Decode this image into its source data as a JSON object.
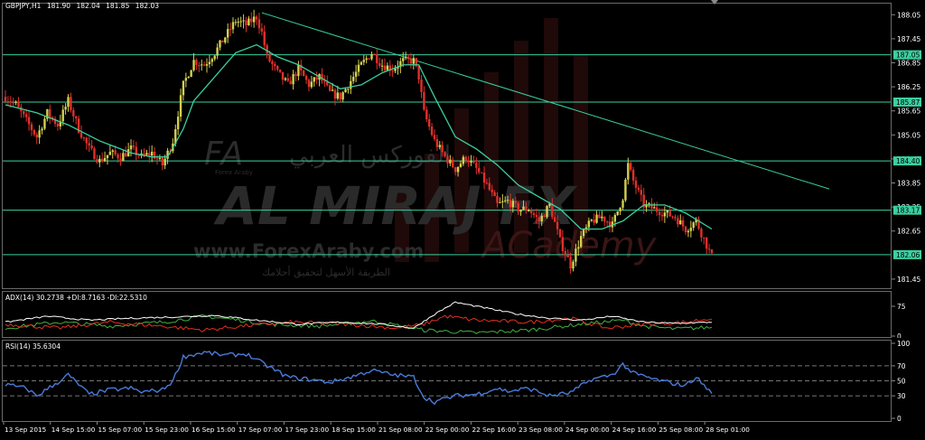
{
  "header": {
    "symbol": "GBPJPY,H1",
    "open": "181.90",
    "high": "182.04",
    "low": "181.85",
    "close": "182.03"
  },
  "adx_header": "ADX(14) 30.2738 +DI:8.7163 -DI:22.5310",
  "rsi_header": "RSI(14) 35.6304",
  "watermark": {
    "name": "AL MIRAJ FX",
    "url": "www.ForexAraby.com",
    "arabic_line": "الفوركس العربي",
    "arabic_tagline": "الطريقة الأسهل لتحقيق أحلامك",
    "academy": "ACademy",
    "logo_text": "FA",
    "logo_sub": "Forex Araby"
  },
  "colors": {
    "bull": "#d4d050",
    "bear": "#e0302a",
    "ma": "#3ad0a0",
    "level": "#3ad0a0",
    "trend": "#3ad0a0",
    "adx": "#ffffff",
    "plus_di": "#40b040",
    "minus_di": "#e03020",
    "rsi": "#4a7ad8",
    "price_label_bg": "#3ad0a0"
  },
  "chart_data": {
    "type": "candlestick",
    "price_ticks": [
      "188.05",
      "187.45",
      "186.85",
      "186.25",
      "185.65",
      "185.05",
      "184.45",
      "183.85",
      "183.25",
      "182.65",
      "181.45"
    ],
    "price_range": [
      181.2,
      188.35
    ],
    "levels": [
      "187.05",
      "185.87",
      "184.40",
      "183.17",
      "182.06"
    ],
    "trendline": {
      "start_price": 188.1,
      "end_price": 183.7
    },
    "time_labels": [
      "13 Sep 2015",
      "14 Sep 15:00",
      "15 Sep 07:00",
      "15 Sep 23:00",
      "16 Sep 15:00",
      "17 Sep 07:00",
      "17 Sep 23:00",
      "18 Sep 15:00",
      "21 Sep 08:00",
      "22 Sep 00:00",
      "22 Sep 16:00",
      "23 Sep 08:00",
      "24 Sep 00:00",
      "24 Sep 16:00",
      "25 Sep 08:00",
      "28 Sep 01:00"
    ],
    "adx": {
      "ticks": [
        "75",
        "0"
      ],
      "range": [
        0,
        100
      ]
    },
    "rsi": {
      "ticks": [
        "100",
        "70",
        "50",
        "30",
        "0"
      ],
      "levels": [
        70,
        50,
        30
      ],
      "range": [
        0,
        100
      ]
    },
    "price_path": [
      [
        0,
        186.0
      ],
      [
        2,
        185.8
      ],
      [
        4,
        185.4
      ],
      [
        6,
        185.0
      ],
      [
        8,
        185.6
      ],
      [
        10,
        185.3
      ],
      [
        12,
        185.9
      ],
      [
        14,
        185.2
      ],
      [
        16,
        184.7
      ],
      [
        18,
        184.4
      ],
      [
        20,
        184.6
      ],
      [
        22,
        184.5
      ],
      [
        24,
        184.7
      ],
      [
        26,
        184.5
      ],
      [
        28,
        184.6
      ],
      [
        30,
        184.3
      ],
      [
        32,
        184.9
      ],
      [
        34,
        186.3
      ],
      [
        36,
        186.9
      ],
      [
        38,
        186.8
      ],
      [
        40,
        187.1
      ],
      [
        42,
        187.5
      ],
      [
        44,
        187.9
      ],
      [
        46,
        187.8
      ],
      [
        48,
        188.0
      ],
      [
        49,
        187.6
      ],
      [
        50,
        187.0
      ],
      [
        52,
        186.6
      ],
      [
        54,
        186.3
      ],
      [
        56,
        186.7
      ],
      [
        58,
        186.3
      ],
      [
        60,
        186.5
      ],
      [
        62,
        186.1
      ],
      [
        64,
        186.0
      ],
      [
        66,
        186.4
      ],
      [
        68,
        186.8
      ],
      [
        70,
        187.1
      ],
      [
        72,
        186.8
      ],
      [
        74,
        186.7
      ],
      [
        76,
        186.9
      ],
      [
        78,
        186.9
      ],
      [
        79,
        186.5
      ],
      [
        80,
        185.6
      ],
      [
        82,
        184.9
      ],
      [
        84,
        184.5
      ],
      [
        86,
        184.2
      ],
      [
        88,
        184.5
      ],
      [
        90,
        184.2
      ],
      [
        92,
        183.8
      ],
      [
        94,
        183.3
      ],
      [
        96,
        183.4
      ],
      [
        98,
        183.2
      ],
      [
        100,
        183.2
      ],
      [
        102,
        182.9
      ],
      [
        104,
        183.3
      ],
      [
        106,
        182.4
      ],
      [
        108,
        181.8
      ],
      [
        110,
        182.5
      ],
      [
        112,
        182.9
      ],
      [
        114,
        183.0
      ],
      [
        116,
        182.8
      ],
      [
        118,
        183.5
      ],
      [
        119,
        184.3
      ],
      [
        120,
        183.9
      ],
      [
        122,
        183.3
      ],
      [
        124,
        183.2
      ],
      [
        126,
        183.1
      ],
      [
        128,
        183.0
      ],
      [
        130,
        182.7
      ],
      [
        132,
        182.9
      ],
      [
        134,
        182.3
      ],
      [
        135,
        182.0
      ]
    ],
    "ma_path": [
      [
        0,
        185.8
      ],
      [
        6,
        185.6
      ],
      [
        12,
        185.3
      ],
      [
        18,
        184.9
      ],
      [
        24,
        184.6
      ],
      [
        28,
        184.5
      ],
      [
        31,
        184.5
      ],
      [
        34,
        185.2
      ],
      [
        36,
        185.9
      ],
      [
        40,
        186.5
      ],
      [
        44,
        187.1
      ],
      [
        48,
        187.3
      ],
      [
        52,
        187.0
      ],
      [
        56,
        186.8
      ],
      [
        60,
        186.5
      ],
      [
        64,
        186.2
      ],
      [
        68,
        186.3
      ],
      [
        72,
        186.6
      ],
      [
        76,
        186.8
      ],
      [
        79,
        186.8
      ],
      [
        82,
        186.0
      ],
      [
        86,
        185.0
      ],
      [
        90,
        184.7
      ],
      [
        94,
        184.3
      ],
      [
        98,
        183.8
      ],
      [
        102,
        183.5
      ],
      [
        106,
        183.2
      ],
      [
        110,
        182.7
      ],
      [
        114,
        182.7
      ],
      [
        118,
        182.9
      ],
      [
        122,
        183.3
      ],
      [
        126,
        183.3
      ],
      [
        130,
        183.1
      ],
      [
        135,
        182.7
      ]
    ],
    "adx_plus_path": [
      [
        0,
        20
      ],
      [
        10,
        35
      ],
      [
        20,
        25
      ],
      [
        30,
        35
      ],
      [
        38,
        50
      ],
      [
        45,
        40
      ],
      [
        50,
        30
      ],
      [
        60,
        25
      ],
      [
        70,
        38
      ],
      [
        80,
        15
      ],
      [
        90,
        8
      ],
      [
        100,
        15
      ],
      [
        110,
        30
      ],
      [
        118,
        40
      ],
      [
        122,
        25
      ],
      [
        128,
        18
      ],
      [
        135,
        22
      ]
    ],
    "adx_minus_path": [
      [
        0,
        30
      ],
      [
        10,
        20
      ],
      [
        20,
        35
      ],
      [
        30,
        25
      ],
      [
        38,
        15
      ],
      [
        45,
        25
      ],
      [
        55,
        35
      ],
      [
        65,
        30
      ],
      [
        75,
        20
      ],
      [
        80,
        30
      ],
      [
        84,
        50
      ],
      [
        90,
        40
      ],
      [
        100,
        35
      ],
      [
        108,
        45
      ],
      [
        115,
        20
      ],
      [
        122,
        30
      ],
      [
        130,
        35
      ],
      [
        135,
        45
      ]
    ],
    "adx_main_path": [
      [
        0,
        35
      ],
      [
        8,
        50
      ],
      [
        16,
        40
      ],
      [
        24,
        45
      ],
      [
        32,
        48
      ],
      [
        40,
        52
      ],
      [
        48,
        40
      ],
      [
        56,
        30
      ],
      [
        64,
        35
      ],
      [
        72,
        30
      ],
      [
        78,
        20
      ],
      [
        82,
        55
      ],
      [
        86,
        85
      ],
      [
        92,
        70
      ],
      [
        98,
        55
      ],
      [
        104,
        45
      ],
      [
        110,
        40
      ],
      [
        116,
        50
      ],
      [
        122,
        35
      ],
      [
        128,
        32
      ],
      [
        135,
        35
      ]
    ],
    "rsi_path": [
      [
        0,
        45
      ],
      [
        4,
        40
      ],
      [
        6,
        30
      ],
      [
        10,
        48
      ],
      [
        12,
        58
      ],
      [
        14,
        45
      ],
      [
        16,
        32
      ],
      [
        20,
        38
      ],
      [
        24,
        40
      ],
      [
        26,
        35
      ],
      [
        30,
        38
      ],
      [
        32,
        50
      ],
      [
        34,
        82
      ],
      [
        38,
        88
      ],
      [
        42,
        84
      ],
      [
        46,
        86
      ],
      [
        48,
        78
      ],
      [
        50,
        70
      ],
      [
        54,
        55
      ],
      [
        58,
        52
      ],
      [
        62,
        48
      ],
      [
        66,
        55
      ],
      [
        70,
        64
      ],
      [
        74,
        58
      ],
      [
        78,
        55
      ],
      [
        80,
        28
      ],
      [
        82,
        22
      ],
      [
        86,
        30
      ],
      [
        90,
        32
      ],
      [
        94,
        40
      ],
      [
        96,
        36
      ],
      [
        100,
        40
      ],
      [
        104,
        30
      ],
      [
        108,
        34
      ],
      [
        112,
        52
      ],
      [
        116,
        58
      ],
      [
        118,
        72
      ],
      [
        120,
        60
      ],
      [
        124,
        52
      ],
      [
        128,
        46
      ],
      [
        130,
        44
      ],
      [
        132,
        55
      ],
      [
        134,
        40
      ],
      [
        135,
        35
      ]
    ]
  }
}
